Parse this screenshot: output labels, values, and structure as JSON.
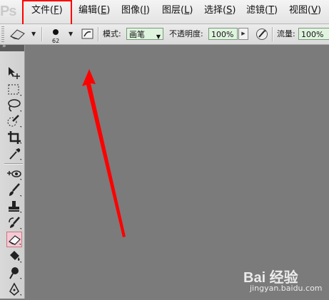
{
  "app": {
    "logo_text": "Ps"
  },
  "menu": [
    {
      "pre": "文件(",
      "key": "F",
      "post": ")"
    },
    {
      "pre": "编辑(",
      "key": "E",
      "post": ")"
    },
    {
      "pre": "图像(",
      "key": "I",
      "post": ")"
    },
    {
      "pre": "图层(",
      "key": "L",
      "post": ")"
    },
    {
      "pre": "选择(",
      "key": "S",
      "post": ")"
    },
    {
      "pre": "滤镜(",
      "key": "T",
      "post": ")"
    },
    {
      "pre": "视图(",
      "key": "V",
      "post": ")"
    }
  ],
  "options": {
    "brush_size": "62",
    "mode_label": "模式:",
    "mode_value": "画笔",
    "opacity_label": "不透明度:",
    "opacity_value": "100%",
    "flow_label": "流量:",
    "flow_value": "100%"
  },
  "tools": [
    "move-tool-icon",
    "marquee-tool-icon",
    "lasso-tool-icon",
    "quick-selection-tool-icon",
    "crop-tool-icon",
    "eyedropper-tool-icon",
    "spot-healing-tool-icon",
    "brush-tool-icon",
    "clone-stamp-tool-icon",
    "history-brush-tool-icon",
    "eraser-tool-icon",
    "paint-bucket-tool-icon",
    "dodge-tool-icon",
    "pen-tool-icon"
  ],
  "watermark": {
    "brand": "Bai 经验",
    "url": "jingyan.baidu.com"
  },
  "colors": {
    "canvas": "#7b7b7b",
    "annotation": "#ff0000",
    "active_tool": "#f4c9d6"
  }
}
